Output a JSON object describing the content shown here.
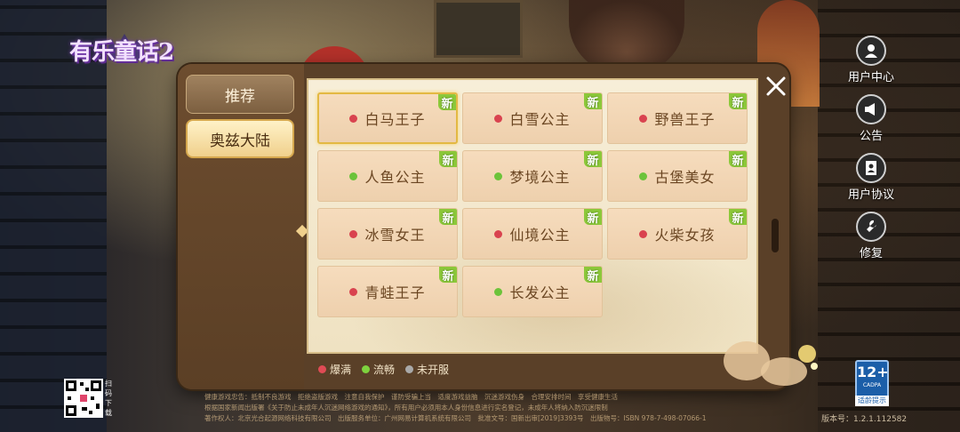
{
  "game": {
    "logo_text": "有乐童话2"
  },
  "sidebar": {
    "tabs": [
      {
        "label": "推荐",
        "active": false
      },
      {
        "label": "奥兹大陆",
        "active": true
      }
    ]
  },
  "servers": [
    {
      "name": "白马王子",
      "status": "full",
      "new_badge": "新",
      "selected": true
    },
    {
      "name": "白雪公主",
      "status": "full",
      "new_badge": "新"
    },
    {
      "name": "野兽王子",
      "status": "full",
      "new_badge": "新"
    },
    {
      "name": "人鱼公主",
      "status": "smooth",
      "new_badge": "新"
    },
    {
      "name": "梦境公主",
      "status": "smooth",
      "new_badge": "新"
    },
    {
      "name": "古堡美女",
      "status": "smooth",
      "new_badge": "新"
    },
    {
      "name": "冰雪女王",
      "status": "full",
      "new_badge": "新"
    },
    {
      "name": "仙境公主",
      "status": "full",
      "new_badge": "新"
    },
    {
      "name": "火柴女孩",
      "status": "full",
      "new_badge": "新"
    },
    {
      "name": "青蛙王子",
      "status": "full",
      "new_badge": "新"
    },
    {
      "name": "长发公主",
      "status": "smooth",
      "new_badge": "新"
    }
  ],
  "legend": [
    {
      "label": "爆满",
      "color": "#e04b55"
    },
    {
      "label": "流畅",
      "color": "#7ed23e"
    },
    {
      "label": "未开服",
      "color": "#a9a9a9"
    }
  ],
  "status_colors": {
    "full": "#d9434f",
    "smooth": "#6cc33a",
    "closed": "#a9a9a9"
  },
  "right_menu": [
    {
      "label": "用户中心",
      "icon": "user-icon"
    },
    {
      "label": "公告",
      "icon": "megaphone-icon"
    },
    {
      "label": "用户协议",
      "icon": "document-user-icon"
    },
    {
      "label": "修复",
      "icon": "wrench-icon"
    }
  ],
  "age_rating": {
    "number": "12+",
    "org": "CADPA",
    "tip": "适龄提示"
  },
  "qr_label": "扫码下载",
  "version": "版本号：1.2.1.112582",
  "notices": [
    "健康游戏忠告：抵制不良游戏　拒绝盗版游戏　注意自我保护　谨防受骗上当　适度游戏益脑　沉迷游戏伤身　合理安排时间　享受健康生活",
    "根据国家新闻出版署《关于防止未成年人沉迷网络游戏的通知》，所有用户必须用本人身份信息进行实名登记，未成年人将纳入防沉迷限制",
    "著作权人：北京光合起源网络科技有限公司　出版服务单位：广州网易计算机系统有限公司　批准文号：国新出审[2019]3393号　出版物号：ISBN 978-7-498-07066-1"
  ]
}
